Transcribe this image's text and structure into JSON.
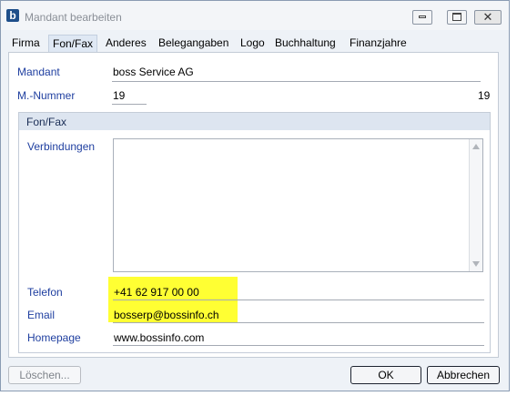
{
  "window": {
    "title": "Mandant bearbeiten",
    "app_icon_letter": "b",
    "close_glyph": "✕"
  },
  "tabs": [
    {
      "label": "Firma"
    },
    {
      "label": "Fon/Fax"
    },
    {
      "label": "Anderes"
    },
    {
      "label": "Belegangaben"
    },
    {
      "label": "Logo"
    },
    {
      "label": "Buchhaltung"
    },
    {
      "label": "Finanzjahre"
    }
  ],
  "active_tab": "Fon/Fax",
  "form": {
    "mandant_label": "Mandant",
    "mandant_value": "boss Service AG",
    "nummer_label": "M.-Nummer",
    "nummer_value": "19",
    "nummer_right": "19"
  },
  "group": {
    "title": "Fon/Fax",
    "verbindungen_label": "Verbindungen",
    "telefon_label": "Telefon",
    "telefon_value": "+41 62 917 00 00",
    "email_label": "Email",
    "email_value": "bosserp@bossinfo.ch",
    "homepage_label": "Homepage",
    "homepage_value": "www.bossinfo.com"
  },
  "buttons": {
    "delete": "Löschen...",
    "ok": "OK",
    "cancel": "Abbrechen"
  },
  "colors": {
    "highlight": "#ffff33",
    "label_blue": "#1f3fa0"
  },
  "icons": [
    "app-logo-icon",
    "minimize-icon",
    "maximize-icon",
    "close-icon",
    "scroll-up-arrow-icon",
    "scroll-down-arrow-icon"
  ]
}
